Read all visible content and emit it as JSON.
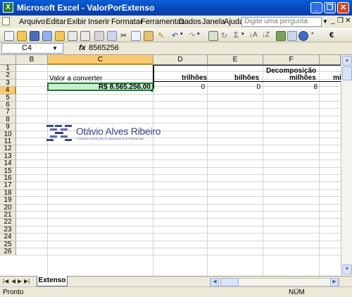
{
  "window": {
    "title": "Microsoft Excel - ValorPorExtenso",
    "app_icon": "X"
  },
  "menu": [
    "Arquivo",
    "Editar",
    "Exibir",
    "Inserir",
    "Formatar",
    "Ferramentas",
    "Dados",
    "Janela",
    "Ajuda"
  ],
  "ask_box": {
    "placeholder": "Digite uma pergunta"
  },
  "formula_bar": {
    "name_box": "C4",
    "fx": "fx",
    "formula": "8565256"
  },
  "columns": [
    "B",
    "C",
    "D",
    "E",
    "F"
  ],
  "rows": [
    "1",
    "2",
    "3",
    "4",
    "5",
    "6",
    "7",
    "8",
    "9",
    "10",
    "11",
    "12",
    "13",
    "14",
    "15",
    "16",
    "17",
    "18",
    "19",
    "20",
    "21",
    "22",
    "23",
    "24",
    "25",
    "26"
  ],
  "cells": {
    "label_valor": "Valor a converter",
    "valor": "R$ 8.565.256,00",
    "decomposicao": "Decomposição",
    "hdr_trilhoes": "trilhões",
    "hdr_bilhoes": "bilhões",
    "hdr_milhoes": "milhões",
    "hdr_partial": "mi",
    "val_trilhoes": "0",
    "val_bilhoes": "0",
    "val_milhoes": "8"
  },
  "logo": {
    "name": "Otávio Alves Ribeiro",
    "tagline": "CONSULTORIA EM PLANILHAS ELETRÔNICAS"
  },
  "sheet_tabs": [
    "Extenso"
  ],
  "status": {
    "left": "Pronto",
    "num": "NÚM"
  },
  "colors": {
    "title_bar": "#0a5fd8",
    "selected_cell_fill": "#c6efce",
    "selection_border": "#1e7b34"
  }
}
